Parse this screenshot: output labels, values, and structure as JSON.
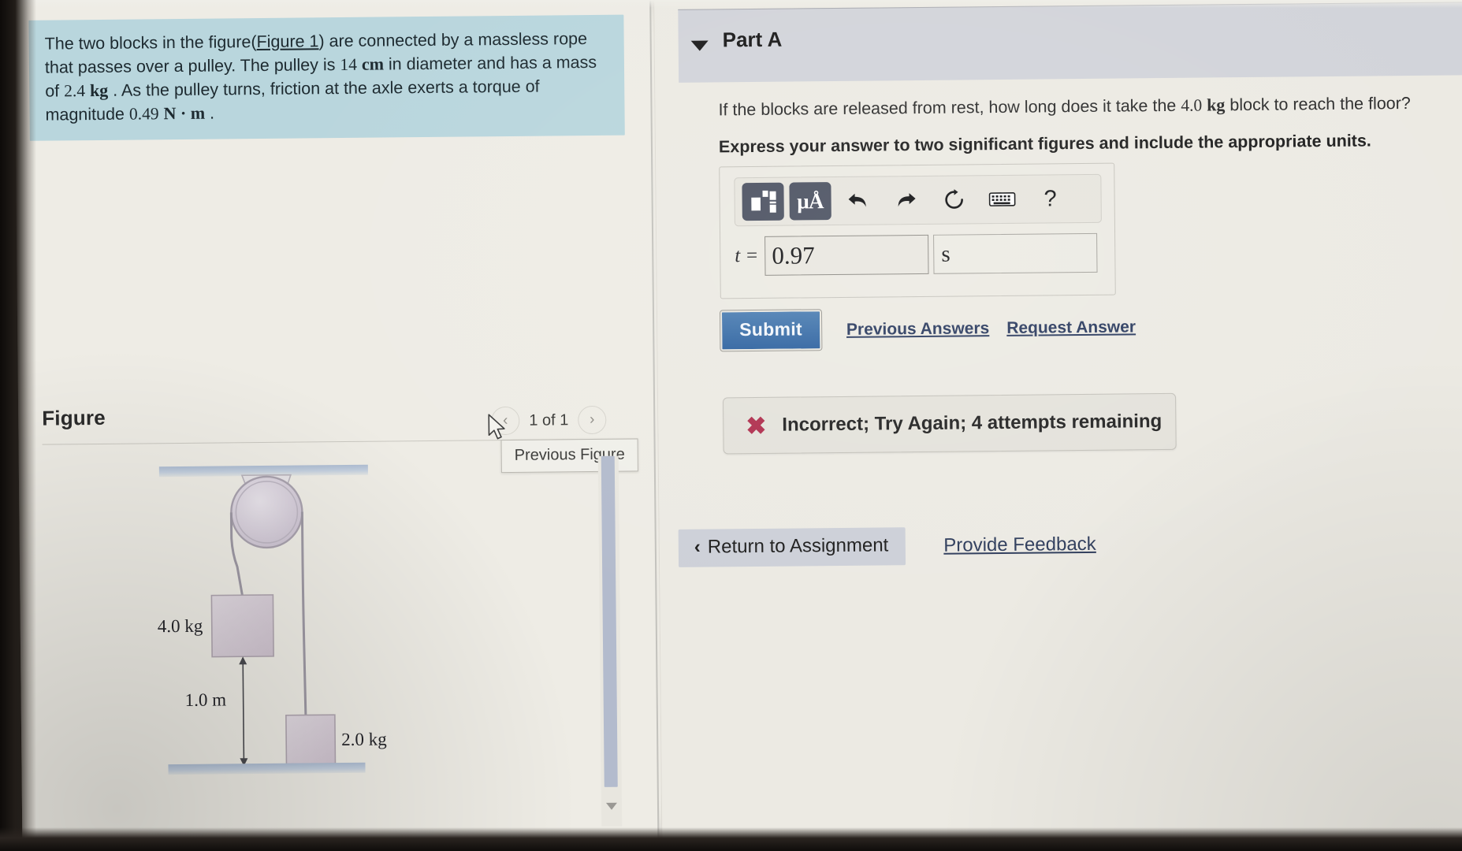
{
  "left": {
    "problem_statement": {
      "line1_a": "The two blocks in the figure(",
      "figure_link": "Figure 1",
      "line1_b": ") are connected by a massless rope that passes over a pulley. The pulley is ",
      "val_diameter": "14",
      "unit_diameter": "cm",
      "line2": " in diameter and has a mass of ",
      "val_mass": "2.4",
      "unit_mass": "kg",
      "line3": " . As the pulley turns, friction at the axle exerts a torque of magnitude ",
      "val_torque": "0.49",
      "unit_torque": "N · m",
      "line4": " ."
    },
    "figure_section": {
      "title": "Figure",
      "prev_arrow": "‹",
      "next_arrow": "›",
      "page_label": "1 of 1",
      "tooltip": "Previous Figure"
    },
    "diagram": {
      "block_left_label": "4.0 kg",
      "block_right_label": "2.0 kg",
      "distance_label": "1.0 m"
    }
  },
  "right": {
    "part": {
      "title": "Part A",
      "collapse_icon": "caret-down"
    },
    "question": {
      "text_a": "If the blocks are released from rest, how long does it take the ",
      "value": "4.0",
      "unit": "kg",
      "text_b": " block to reach the floor?",
      "instruction": "Express your answer to two significant figures and include the appropriate units."
    },
    "toolbar": {
      "items": [
        {
          "name": "template-button",
          "glyph": "□"
        },
        {
          "name": "units-button",
          "glyph": "μÅ"
        },
        {
          "name": "undo-button",
          "glyph": "↶"
        },
        {
          "name": "redo-button",
          "glyph": "↷"
        },
        {
          "name": "reset-button",
          "glyph": "↻"
        },
        {
          "name": "keyboard-button",
          "glyph": "⌨"
        },
        {
          "name": "help-button",
          "glyph": "?"
        }
      ]
    },
    "answer": {
      "variable_label": "t =",
      "value": "0.97",
      "unit": "s",
      "value_placeholder": "",
      "unit_placeholder": ""
    },
    "actions": {
      "submit_label": "Submit",
      "previous_answers_label": "Previous Answers",
      "request_answer_label": "Request Answer"
    },
    "result": {
      "icon": "x-mark",
      "message": "Incorrect; Try Again; 4 attempts remaining"
    },
    "footer": {
      "return_label": "Return to Assignment",
      "return_chevron": "‹",
      "feedback_label": "Provide Feedback"
    }
  },
  "colors": {
    "problem_box_bg": "#b9d6dd",
    "part_header_bg": "#d2d4da",
    "submit_blue": "#3a6ea5",
    "link_blue": "#2c3c60",
    "error_red": "#b0304f",
    "page_bg": "#eceae3",
    "scrollbar_thumb": "#b3bbcd"
  }
}
